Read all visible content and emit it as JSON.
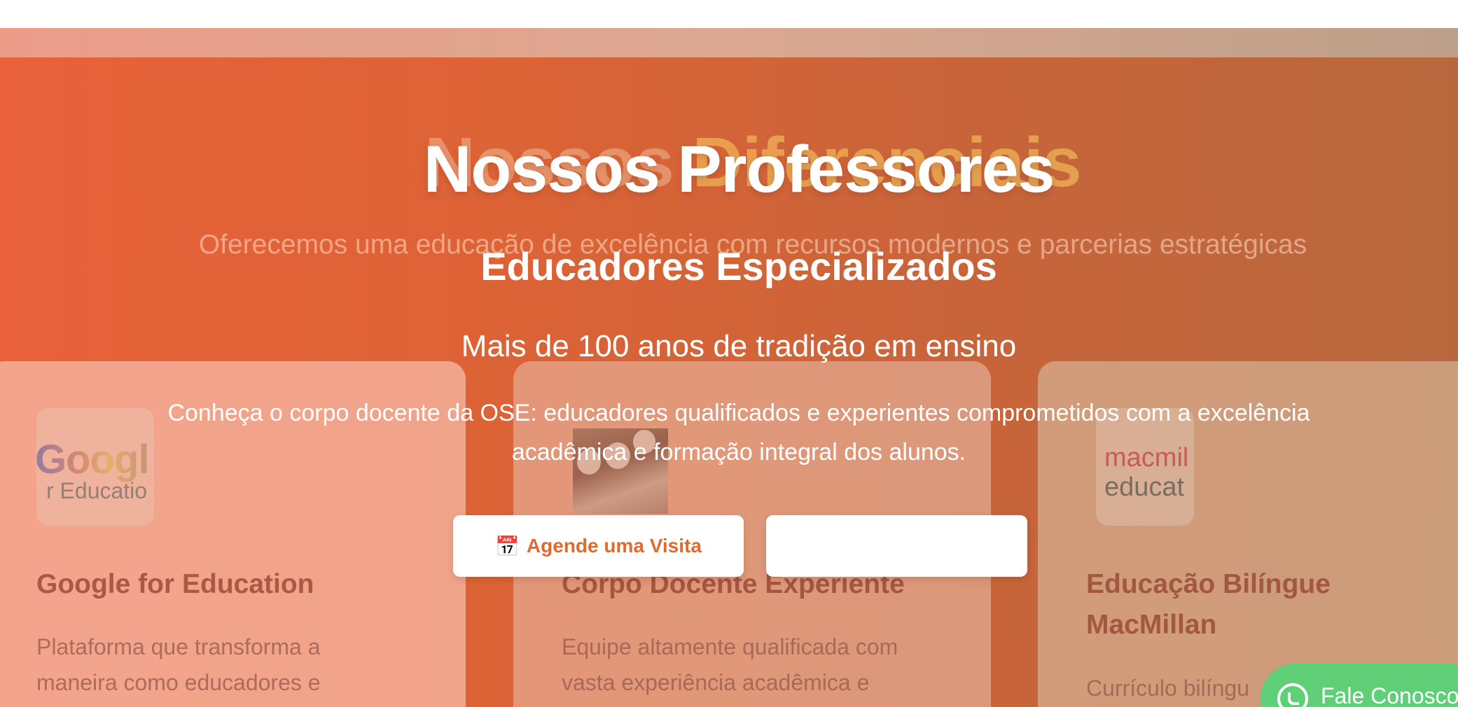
{
  "background_section": {
    "title_part1": "Nossos ",
    "title_part2": "Diferenciais",
    "subtitle": "Oferecemos uma educação de excelência com recursos modernos e parcerias estratégicas",
    "cards": [
      {
        "logo_text": "Googl",
        "logo_subtext": "r Educatio",
        "title": "Google for Education",
        "description_lines": [
          "Plataforma que transforma a",
          "maneira como educadores e"
        ]
      },
      {
        "title": "Corpo Docente Experiente",
        "description_lines": [
          "Equipe altamente qualificada com",
          "vasta experiência acadêmica e"
        ]
      },
      {
        "logo_text_1": "macmil",
        "logo_text_2": "educat",
        "title_lines": [
          "Educação Bilíngue",
          "MacMillan"
        ],
        "description_lines": [
          "Currículo bilíngu"
        ]
      }
    ]
  },
  "overlay": {
    "title": "Nossos Professores",
    "subtitle": "Educadores Especializados",
    "tagline": "Mais de 100 anos de tradição em ensino",
    "description": "Conheça o corpo docente da OSE: educadores qualificados e experientes comprometidos com a excelência acadêmica e formação integral dos alunos.",
    "visit_button_label": "Agende uma Visita",
    "visit_button_icon": "📅",
    "second_button_label": ""
  },
  "whatsapp": {
    "label": "Fale Conosco",
    "icon": "whatsapp-icon"
  },
  "colors": {
    "hero_start": "#e8613a",
    "hero_end": "#b9683d",
    "accent_button_text": "#e06b30",
    "whatsapp_green": "#5fcf78"
  }
}
